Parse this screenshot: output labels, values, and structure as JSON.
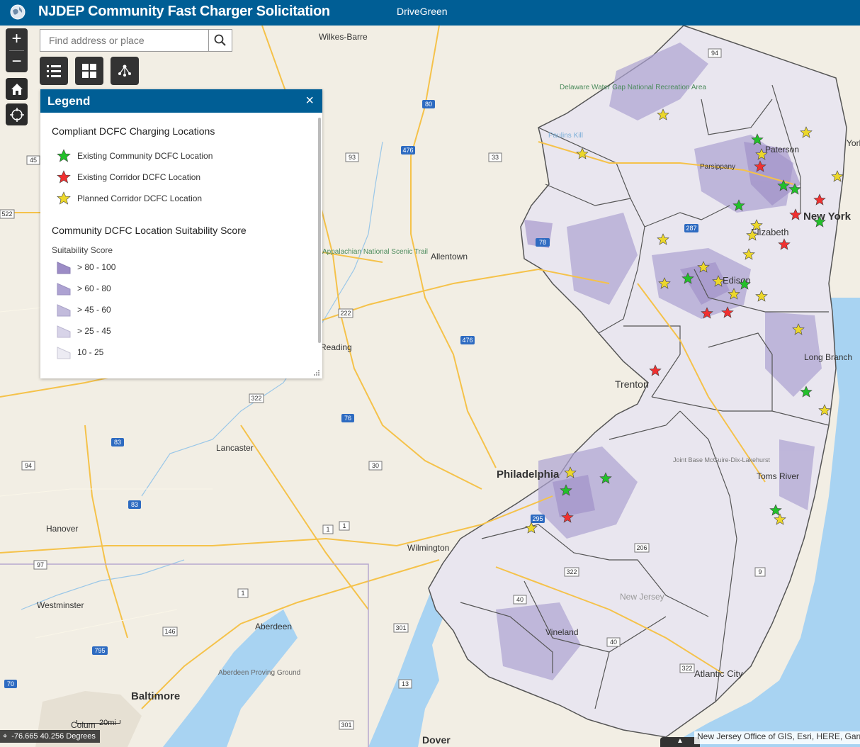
{
  "header": {
    "title": "NJDEP Community Fast Charger Solicitation",
    "subtitle": "DriveGreen"
  },
  "search": {
    "placeholder": "Find address or place"
  },
  "zoom": {
    "in": "+",
    "out": "−"
  },
  "legend": {
    "title": "Legend",
    "close": "×",
    "section1": "Compliant DCFC Charging Locations",
    "points": [
      {
        "label": "Existing Community DCFC Location",
        "color": "#22c02a"
      },
      {
        "label": "Existing Corridor DCFC Location",
        "color": "#f03030"
      },
      {
        "label": "Planned Corridor DCFC Location",
        "color": "#ecd72a"
      }
    ],
    "section2": "Community DCFC Location Suitability Score",
    "score_label": "Suitability Score",
    "classes": [
      {
        "label": "> 80 - 100",
        "color": "#9c8cc6"
      },
      {
        "label": "> 60 - 80",
        "color": "#ada2d2"
      },
      {
        "label": "> 45 - 60",
        "color": "#c2bbdc"
      },
      {
        "label": "> 25 - 45",
        "color": "#d7d3e8"
      },
      {
        "label": "10 - 25",
        "color": "#ecebf3"
      }
    ]
  },
  "map": {
    "cities": [
      "Wilkes-Barre",
      "Allentown",
      "Reading",
      "Lancaster",
      "Hanover",
      "Westminster",
      "Aberdeen",
      "Baltimore",
      "Philadelphia",
      "Wilmington",
      "Trenton",
      "Paterson",
      "Parsippany",
      "Elizabeth",
      "Edison",
      "New York",
      "Long Branch",
      "Toms River",
      "Vineland",
      "Atlantic City",
      "Dover",
      "Columbia",
      "Delaware Water Gap National Recreation Area",
      "Appalachian National Scenic Trail",
      "Aberdeen Proving Ground",
      "Joint Base McGuire-Dix-Lakehurst",
      "New Jersey",
      "Paulins Kill"
    ],
    "routes": [
      "80",
      "476",
      "33",
      "93",
      "78",
      "222",
      "476",
      "322",
      "76",
      "83",
      "30",
      "94",
      "83",
      "1",
      "1",
      "97",
      "1",
      "146",
      "301",
      "795",
      "70",
      "13",
      "301",
      "295",
      "322",
      "40",
      "40",
      "206",
      "9",
      "322",
      "322",
      "94",
      "287",
      "45",
      "522"
    ]
  },
  "status": {
    "coords": "-76.665 40.256 Degrees",
    "scale": "20mi",
    "attribution": "New Jersey Office of GIS, Esri, HERE, Garmin"
  }
}
